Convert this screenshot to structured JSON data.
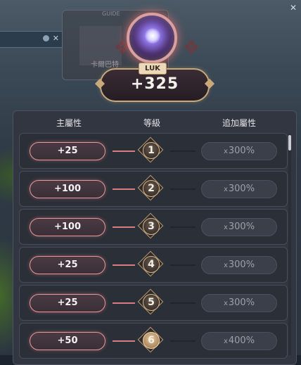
{
  "background": {
    "guide_label": "GUIDE",
    "guide_caption": "卡爾巴特",
    "close_glyph": "✕"
  },
  "stat": {
    "name": "LUK",
    "value": "+325"
  },
  "table": {
    "headers": [
      "主屬性",
      "等級",
      "追加屬性"
    ],
    "rows": [
      {
        "main": "+25",
        "level": "1",
        "extra": "300%"
      },
      {
        "main": "+100",
        "level": "2",
        "extra": "300%"
      },
      {
        "main": "+100",
        "level": "3",
        "extra": "300%"
      },
      {
        "main": "+25",
        "level": "4",
        "extra": "300%"
      },
      {
        "main": "+25",
        "level": "5",
        "extra": "300%"
      },
      {
        "main": "+50",
        "level": "6",
        "extra": "400%"
      }
    ],
    "multiplier_symbol": "x"
  },
  "colors": {
    "accent_pink": "#e79a9a",
    "gold": "#c9a97a",
    "panel_bg": "#313641"
  }
}
